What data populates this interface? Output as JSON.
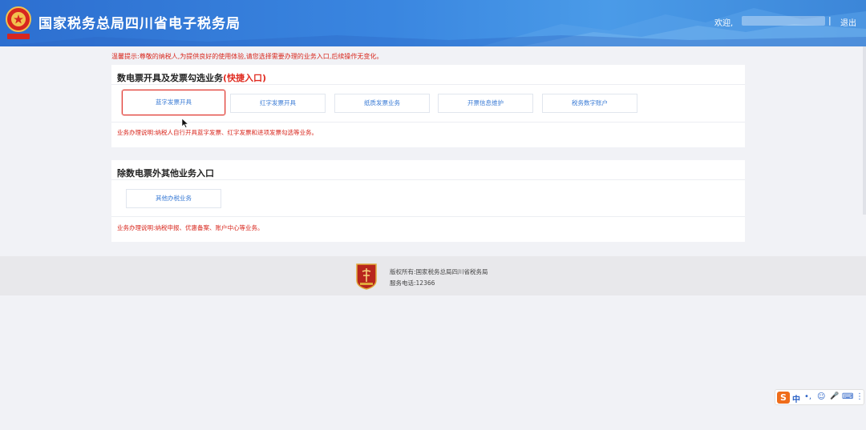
{
  "header": {
    "site_title": "国家税务总局四川省电子税务局",
    "welcome_label": "欢迎,",
    "separator": "|",
    "logout_label": "退出"
  },
  "notice": "温馨提示:尊敬的纳税人,为提供良好的使用体验,请您选择需要办理的业务入口,后续操作无变化。",
  "section_einvoice": {
    "title": "数电票开具及发票勾选业务",
    "quick_label": "(快捷入口)",
    "buttons": [
      {
        "label": "蓝字发票开具"
      },
      {
        "label": "红字发票开具"
      },
      {
        "label": "纸质发票业务"
      },
      {
        "label": "开票信息维护"
      },
      {
        "label": "税务数字账户"
      }
    ],
    "description": "业务办理说明:纳税人自行开具蓝字发票、红字发票和进项发票勾选等业务。"
  },
  "section_other": {
    "title": "除数电票外其他业务入口",
    "buttons": [
      {
        "label": "其他办税业务"
      }
    ],
    "description": "业务办理说明:纳税申报、优惠备案、账户中心等业务。"
  },
  "footer": {
    "copyright": "版权所有:国家税务总局四川省税务局",
    "phone": "服务电话:12366"
  },
  "ime": {
    "logo_letter": "S",
    "mode_label": "中",
    "punct": "•,",
    "emoji": "☺",
    "mic": "🎤",
    "keyboard": "⌨",
    "menu": "⋮"
  },
  "colors": {
    "header_blue": "#3a86e0",
    "notice_red": "#d8261c",
    "link_blue": "#3a7bd5",
    "active_border": "#e23a33"
  }
}
